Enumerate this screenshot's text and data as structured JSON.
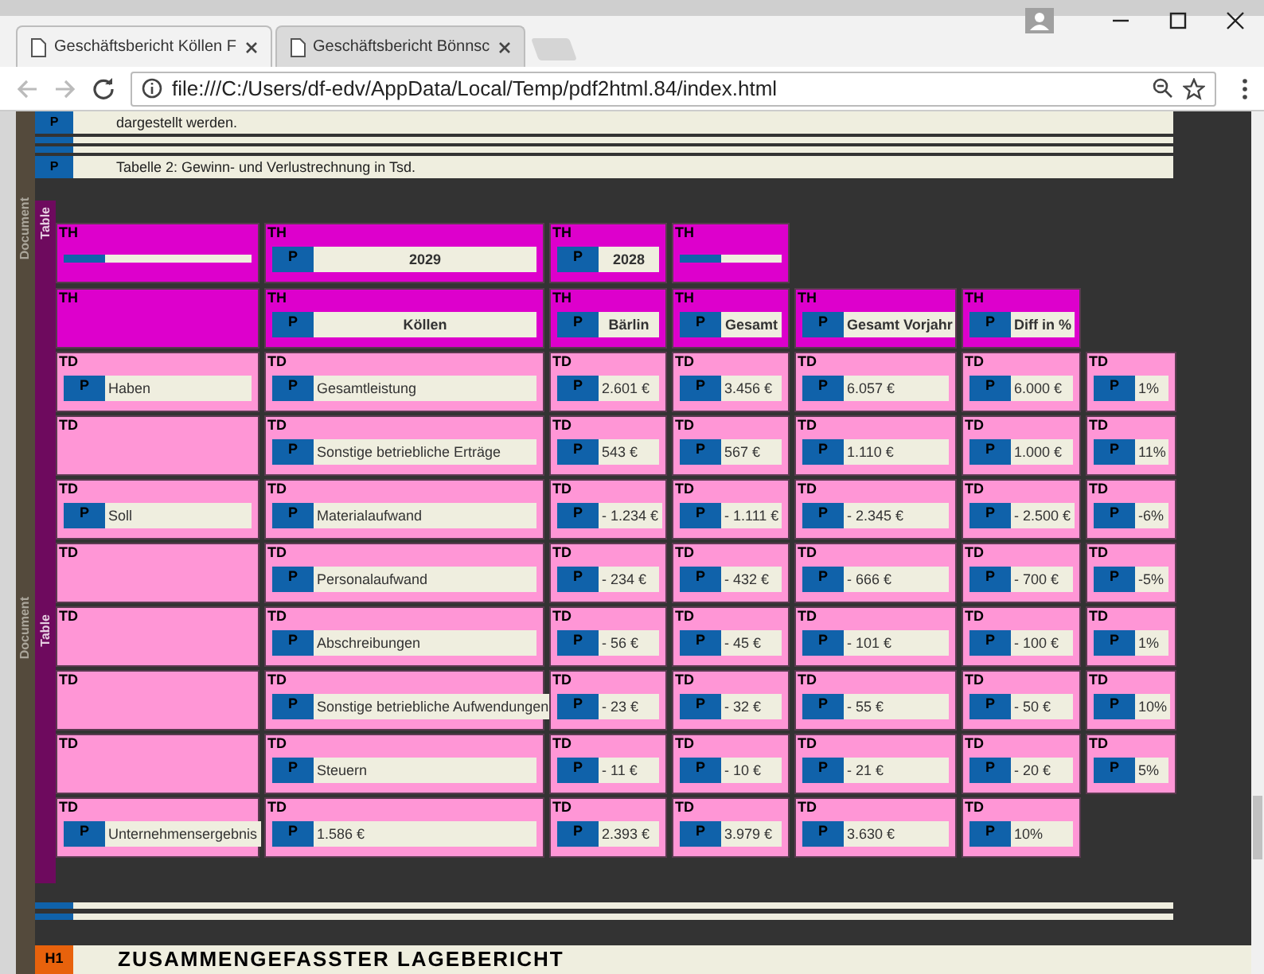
{
  "tabs": [
    {
      "title": "Geschäftsbericht Köllen F",
      "selected": true
    },
    {
      "title": "Geschäftsbericht Bönnsc",
      "selected": false
    }
  ],
  "address": "file:///C:/Users/df-edv/AppData/Local/Temp/pdf2html.84/index.html",
  "side_labels": {
    "document": [
      "Document",
      "Document"
    ],
    "table": [
      "Table",
      "Table"
    ]
  },
  "blocks_before": [
    {
      "tag": "P",
      "kind": "text",
      "text": "dargestellt werden."
    },
    {
      "kind": "empty"
    },
    {
      "kind": "empty"
    },
    {
      "tag": "P",
      "kind": "text",
      "text": "Tabelle 2: Gewinn- und Verlustrechnung in Tsd."
    }
  ],
  "table": {
    "rows": [
      {
        "cells": [
          {
            "tag": "TH",
            "kind": "empty"
          },
          {
            "tag": "TH",
            "kind": "text",
            "p": "P",
            "text": "2029"
          },
          {
            "tag": "TH",
            "kind": "text",
            "p": "P",
            "text": "2028"
          },
          {
            "tag": "TH",
            "kind": "empty"
          }
        ]
      },
      {
        "cells": [
          {
            "tag": "TH",
            "kind": "blank"
          },
          {
            "tag": "TH",
            "kind": "text",
            "p": "P",
            "text": "Köllen"
          },
          {
            "tag": "TH",
            "kind": "text",
            "p": "P",
            "text": "Bärlin"
          },
          {
            "tag": "TH",
            "kind": "text",
            "p": "P",
            "text": "Gesamt"
          },
          {
            "tag": "TH",
            "kind": "text",
            "p": "P",
            "text": "Gesamt Vorjahr"
          },
          {
            "tag": "TH",
            "kind": "text",
            "p": "P",
            "text": "Diff in %"
          }
        ]
      },
      {
        "cells": [
          {
            "tag": "TD",
            "kind": "text",
            "p": "P",
            "text": "Haben"
          },
          {
            "tag": "TD",
            "kind": "text",
            "p": "P",
            "text": "Gesamtleistung"
          },
          {
            "tag": "TD",
            "kind": "text",
            "p": "P",
            "text": "2.601 €"
          },
          {
            "tag": "TD",
            "kind": "text",
            "p": "P",
            "text": "3.456 €"
          },
          {
            "tag": "TD",
            "kind": "text",
            "p": "P",
            "text": "6.057 €"
          },
          {
            "tag": "TD",
            "kind": "text",
            "p": "P",
            "text": "6.000 €"
          },
          {
            "tag": "TD",
            "kind": "text",
            "p": "P",
            "text": "1%"
          }
        ]
      },
      {
        "cells": [
          {
            "tag": "TD",
            "kind": "blank"
          },
          {
            "tag": "TD",
            "kind": "text",
            "p": "P",
            "text": "Sonstige betriebliche Erträge"
          },
          {
            "tag": "TD",
            "kind": "text",
            "p": "P",
            "text": "543 €"
          },
          {
            "tag": "TD",
            "kind": "text",
            "p": "P",
            "text": "567 €"
          },
          {
            "tag": "TD",
            "kind": "text",
            "p": "P",
            "text": "1.110 €"
          },
          {
            "tag": "TD",
            "kind": "text",
            "p": "P",
            "text": "1.000 €"
          },
          {
            "tag": "TD",
            "kind": "text",
            "p": "P",
            "text": "11%"
          }
        ]
      },
      {
        "cells": [
          {
            "tag": "TD",
            "kind": "text",
            "p": "P",
            "text": "Soll"
          },
          {
            "tag": "TD",
            "kind": "text",
            "p": "P",
            "text": "Materialaufwand"
          },
          {
            "tag": "TD",
            "kind": "text",
            "p": "P",
            "text": "- 1.234 €"
          },
          {
            "tag": "TD",
            "kind": "text",
            "p": "P",
            "text": "- 1.111 €"
          },
          {
            "tag": "TD",
            "kind": "text",
            "p": "P",
            "text": "- 2.345 €"
          },
          {
            "tag": "TD",
            "kind": "text",
            "p": "P",
            "text": "- 2.500 €"
          },
          {
            "tag": "TD",
            "kind": "text",
            "p": "P",
            "text": "-6%"
          }
        ]
      },
      {
        "cells": [
          {
            "tag": "TD",
            "kind": "blank"
          },
          {
            "tag": "TD",
            "kind": "text",
            "p": "P",
            "text": "Personalaufwand"
          },
          {
            "tag": "TD",
            "kind": "text",
            "p": "P",
            "text": "- 234 €"
          },
          {
            "tag": "TD",
            "kind": "text",
            "p": "P",
            "text": "- 432 €"
          },
          {
            "tag": "TD",
            "kind": "text",
            "p": "P",
            "text": "- 666 €"
          },
          {
            "tag": "TD",
            "kind": "text",
            "p": "P",
            "text": "- 700 €"
          },
          {
            "tag": "TD",
            "kind": "text",
            "p": "P",
            "text": "-5%"
          }
        ]
      },
      {
        "cells": [
          {
            "tag": "TD",
            "kind": "blank"
          },
          {
            "tag": "TD",
            "kind": "text",
            "p": "P",
            "text": "Abschreibungen"
          },
          {
            "tag": "TD",
            "kind": "text",
            "p": "P",
            "text": "- 56 €"
          },
          {
            "tag": "TD",
            "kind": "text",
            "p": "P",
            "text": "- 45 €"
          },
          {
            "tag": "TD",
            "kind": "text",
            "p": "P",
            "text": "- 101 €"
          },
          {
            "tag": "TD",
            "kind": "text",
            "p": "P",
            "text": "- 100 €"
          },
          {
            "tag": "TD",
            "kind": "text",
            "p": "P",
            "text": "1%"
          }
        ]
      },
      {
        "cells": [
          {
            "tag": "TD",
            "kind": "blank"
          },
          {
            "tag": "TD",
            "kind": "text",
            "p": "P",
            "text": "Sonstige betriebliche Aufwendungen"
          },
          {
            "tag": "TD",
            "kind": "text",
            "p": "P",
            "text": "- 23 €"
          },
          {
            "tag": "TD",
            "kind": "text",
            "p": "P",
            "text": "- 32 €"
          },
          {
            "tag": "TD",
            "kind": "text",
            "p": "P",
            "text": "- 55 €"
          },
          {
            "tag": "TD",
            "kind": "text",
            "p": "P",
            "text": "- 50 €"
          },
          {
            "tag": "TD",
            "kind": "text",
            "p": "P",
            "text": "10%"
          }
        ]
      },
      {
        "cells": [
          {
            "tag": "TD",
            "kind": "blank"
          },
          {
            "tag": "TD",
            "kind": "text",
            "p": "P",
            "text": "Steuern"
          },
          {
            "tag": "TD",
            "kind": "text",
            "p": "P",
            "text": "- 11 €"
          },
          {
            "tag": "TD",
            "kind": "text",
            "p": "P",
            "text": "- 10 €"
          },
          {
            "tag": "TD",
            "kind": "text",
            "p": "P",
            "text": "- 21 €"
          },
          {
            "tag": "TD",
            "kind": "text",
            "p": "P",
            "text": "- 20 €"
          },
          {
            "tag": "TD",
            "kind": "text",
            "p": "P",
            "text": "5%"
          }
        ]
      },
      {
        "cells": [
          {
            "tag": "TD",
            "kind": "text",
            "p": "P",
            "text": "Unternehmensergebnis"
          },
          {
            "tag": "TD",
            "kind": "text",
            "p": "P",
            "text": "1.586 €"
          },
          {
            "tag": "TD",
            "kind": "text",
            "p": "P",
            "text": "2.393 €"
          },
          {
            "tag": "TD",
            "kind": "text",
            "p": "P",
            "text": "3.979 €"
          },
          {
            "tag": "TD",
            "kind": "text",
            "p": "P",
            "text": "3.630 €"
          },
          {
            "tag": "TD",
            "kind": "text",
            "p": "P",
            "text": "10%"
          }
        ]
      }
    ]
  },
  "blocks_after": [
    {
      "kind": "empty"
    },
    {
      "kind": "empty"
    }
  ],
  "heading": {
    "tag": "H1",
    "text": "ZUSAMMENGEFASSTER LAGEBERICHT"
  }
}
